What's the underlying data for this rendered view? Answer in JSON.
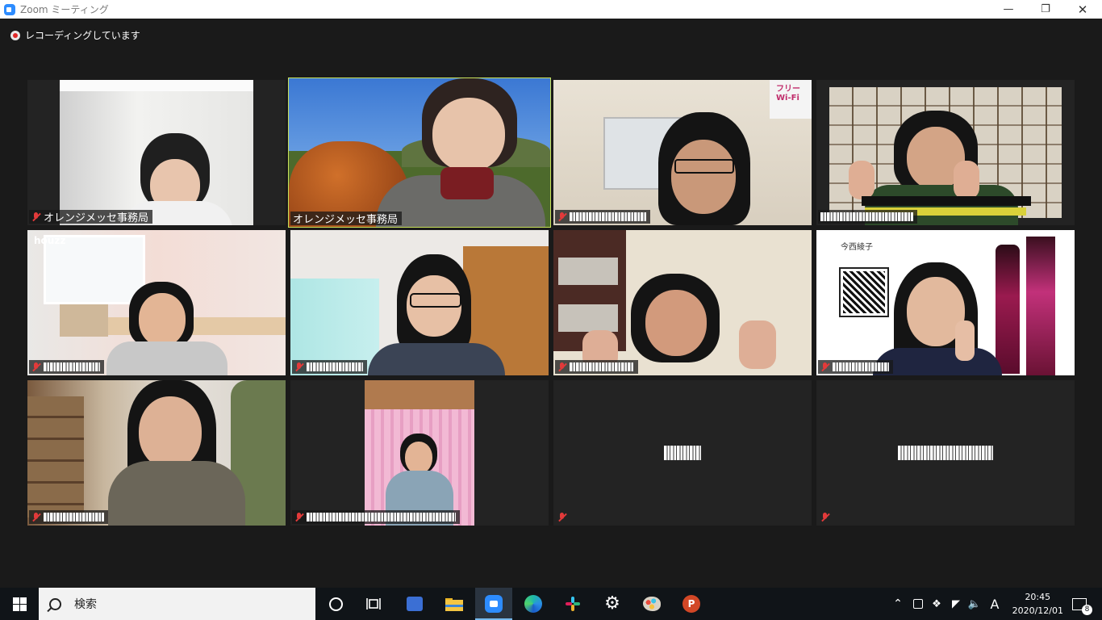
{
  "window": {
    "title": "Zoom ミーティング",
    "app_icon": "zoom-icon"
  },
  "recording": {
    "label": "レコーディングしています"
  },
  "participants": [
    {
      "name": "オレンジメッセ事務局",
      "muted": true
    },
    {
      "name": "オレンジメッセ事務局",
      "muted": false,
      "active_speaker": true
    },
    {
      "name": "",
      "muted": true
    },
    {
      "name": "",
      "muted": false
    },
    {
      "name": "",
      "muted": true
    },
    {
      "name": "",
      "muted": true
    },
    {
      "name": "",
      "muted": true
    },
    {
      "name": "",
      "muted": true
    },
    {
      "name": "",
      "muted": true
    },
    {
      "name": "",
      "muted": true
    },
    {
      "name": "",
      "muted": true,
      "video_off": true
    },
    {
      "name": "",
      "muted": true,
      "video_off": true
    }
  ],
  "tile_labels": {
    "houzz": "houzz",
    "lawson_top": "今西綾子",
    "wifi": "フリー Wi-Fi"
  },
  "taskbar": {
    "search_placeholder": "検索",
    "time": "20:45",
    "date": "2020/12/01",
    "ime": "A",
    "notification_count": "8"
  },
  "colors": {
    "active_border": "#c9e25b",
    "mute_red": "#e23a3a",
    "zoom_blue": "#2d8cff"
  }
}
